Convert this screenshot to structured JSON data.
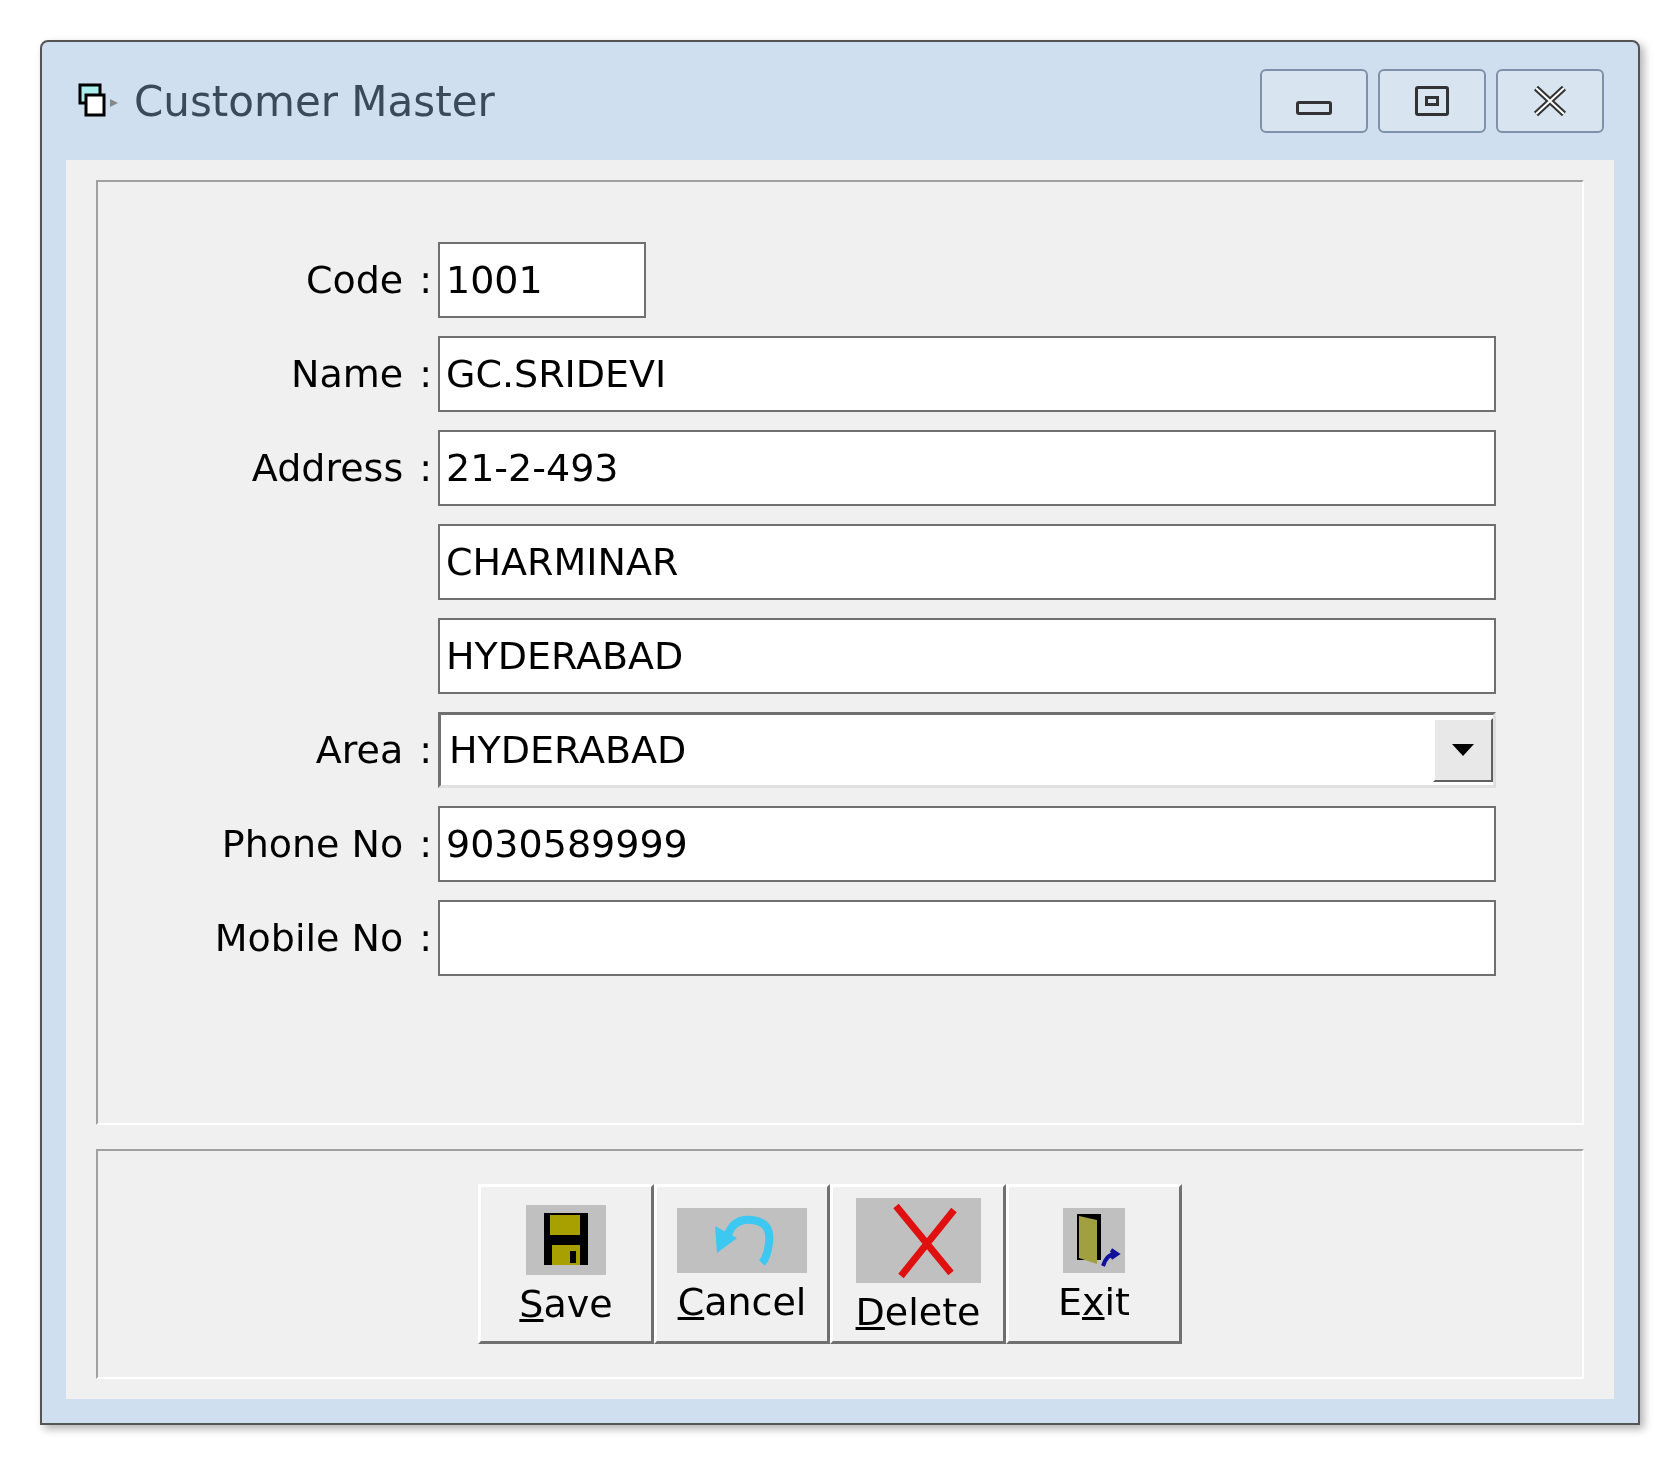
{
  "window": {
    "title": "Customer Master"
  },
  "fields": [
    {
      "kind": "short_text",
      "label": "Code",
      "colon": ":",
      "value": "1001"
    },
    {
      "kind": "text",
      "label": "Name",
      "colon": ":",
      "value": "GC.SRIDEVI"
    },
    {
      "kind": "text",
      "label": "Address",
      "colon": ":",
      "value": "21-2-493"
    },
    {
      "kind": "text",
      "value": "CHARMINAR"
    },
    {
      "kind": "text",
      "value": "HYDERABAD"
    },
    {
      "kind": "dropdown",
      "label": "Area",
      "colon": ":",
      "value": "HYDERABAD"
    },
    {
      "kind": "text",
      "label": "Phone No",
      "colon": ":",
      "value": "9030589999"
    },
    {
      "kind": "text",
      "label": "Mobile No",
      "colon": ":"
    }
  ],
  "buttons": [
    {
      "kind": "save",
      "key": "S",
      "after": "ave"
    },
    {
      "kind": "cancel",
      "key": "C",
      "after": "ancel"
    },
    {
      "kind": "delete",
      "key": "D",
      "after": "elete"
    },
    {
      "kind": "exit",
      "before": "E",
      "key": "x",
      "after": "it"
    }
  ]
}
